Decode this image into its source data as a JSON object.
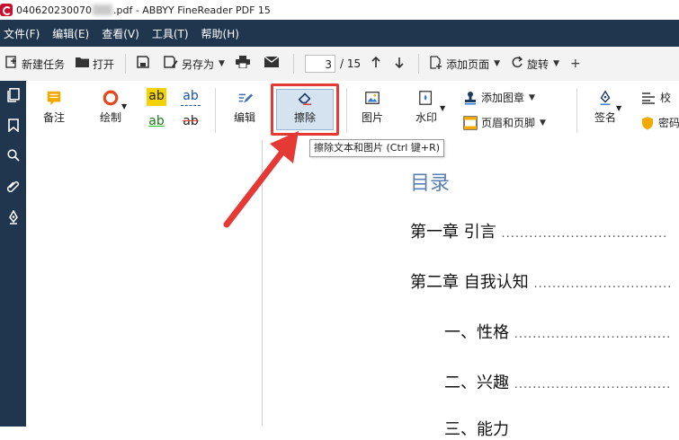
{
  "window": {
    "title_part1": "040620230070",
    "title_part2": ".pdf - ABBYY FineReader PDF 15"
  },
  "menu": [
    {
      "label": "文件(F)"
    },
    {
      "label": "编辑(E)"
    },
    {
      "label": "查看(V)"
    },
    {
      "label": "工具(T)"
    },
    {
      "label": "帮助(H)"
    }
  ],
  "toolbar": {
    "new_task": "新建任务",
    "open": "打开",
    "save_as": "另存为",
    "page_current": "3",
    "page_total": "/ 15",
    "add_page": "添加页面",
    "rotate": "旋转"
  },
  "ribbon": {
    "note": "备注",
    "draw": "绘制",
    "highlight_text": "ab",
    "edit": "编辑",
    "erase": "擦除",
    "image": "图片",
    "watermark": "水印",
    "add_stamp": "添加图章",
    "header_footer": "页眉和页脚",
    "sign": "签名",
    "proof": "校",
    "password": "密码"
  },
  "tooltip": {
    "text": "擦除文本和图片 (Ctrl 键+R)"
  },
  "document": {
    "toc_title": "目录",
    "lines": [
      {
        "text": "第一章  引言"
      },
      {
        "text": "第二章  自我认知"
      },
      {
        "text": "一、性格"
      },
      {
        "text": "二、兴趣"
      },
      {
        "text": "三、能力"
      }
    ]
  },
  "colors": {
    "menubar_bg": "#20364f",
    "highlight_border": "#e53935",
    "toc_title": "#5a7fb5",
    "arrow": "#e53935"
  }
}
